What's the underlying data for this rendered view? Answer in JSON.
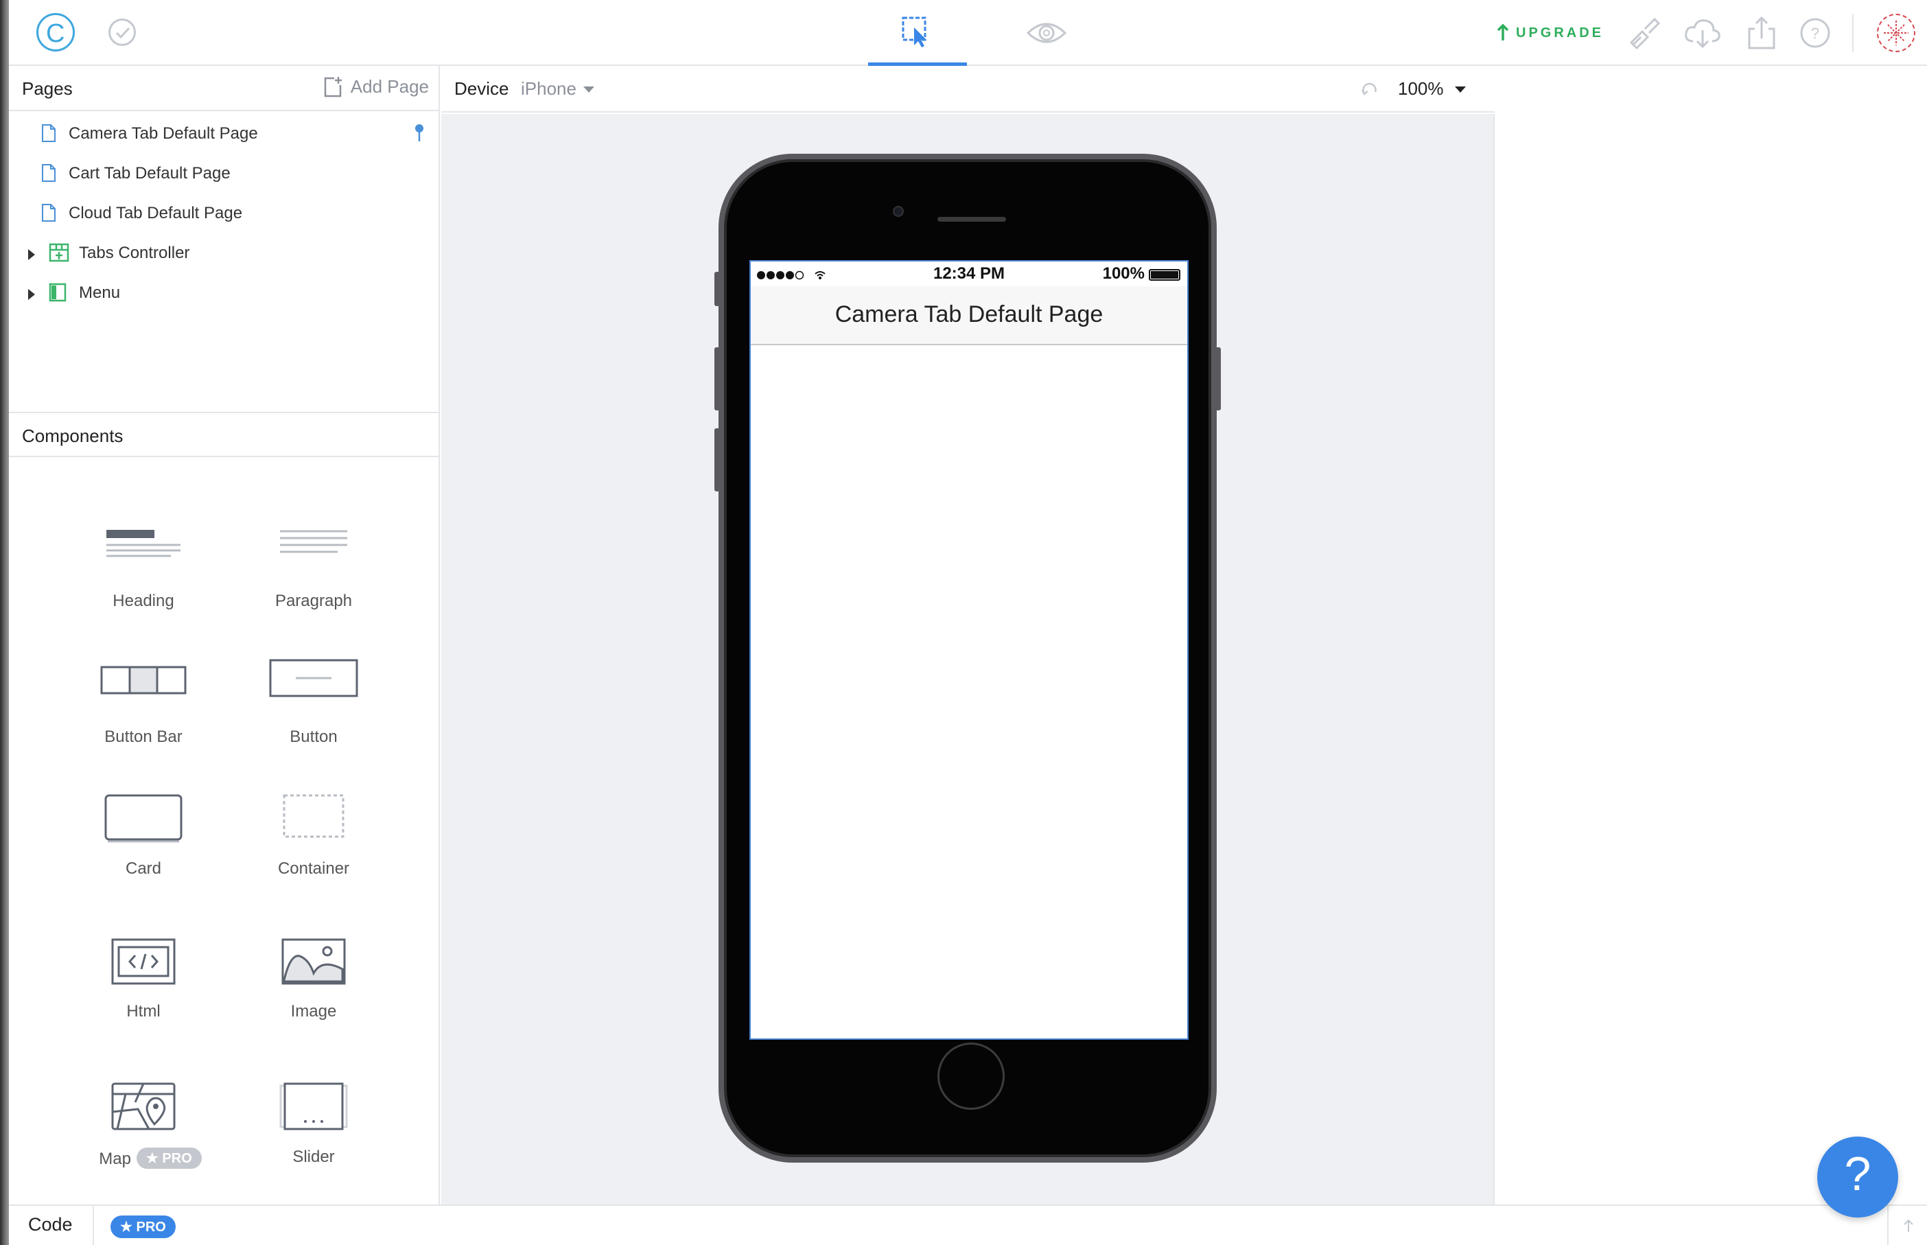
{
  "topbar": {
    "logo_letter": "C",
    "upgrade_label": "UPGRADE",
    "colors": {
      "accent": "#3a86e6",
      "upgrade": "#2fae5c",
      "logo": "#3ea7dd"
    }
  },
  "pages_panel": {
    "title": "Pages",
    "add_page_label": "Add Page",
    "items": [
      {
        "label": "Camera Tab Default Page",
        "type": "page",
        "icon": "document-icon",
        "pinned": true
      },
      {
        "label": "Cart Tab Default Page",
        "type": "page",
        "icon": "document-icon"
      },
      {
        "label": "Cloud Tab Default Page",
        "type": "page",
        "icon": "document-icon"
      },
      {
        "label": "Tabs Controller",
        "type": "group",
        "icon": "tabs-controller-icon"
      },
      {
        "label": "Menu",
        "type": "group",
        "icon": "menu-icon"
      }
    ]
  },
  "components_panel": {
    "title": "Components",
    "items": [
      {
        "label": "Heading",
        "icon": "heading-icon"
      },
      {
        "label": "Paragraph",
        "icon": "paragraph-icon"
      },
      {
        "label": "Button Bar",
        "icon": "button-bar-icon"
      },
      {
        "label": "Button",
        "icon": "button-icon"
      },
      {
        "label": "Card",
        "icon": "card-icon"
      },
      {
        "label": "Container",
        "icon": "container-icon"
      },
      {
        "label": "Html",
        "icon": "html-icon"
      },
      {
        "label": "Image",
        "icon": "image-icon"
      },
      {
        "label": "Map",
        "icon": "map-icon",
        "badge": "★ PRO"
      },
      {
        "label": "Slider",
        "icon": "slider-icon"
      }
    ]
  },
  "canvas": {
    "device_label": "Device",
    "device_value": "iPhone",
    "zoom": "100%"
  },
  "phone_screen": {
    "status_time": "12:34 PM",
    "battery": "100%",
    "page_title": "Camera Tab Default Page"
  },
  "bottombar": {
    "code_label": "Code",
    "pro_badge": "★ PRO"
  },
  "help": {
    "label": "?"
  }
}
